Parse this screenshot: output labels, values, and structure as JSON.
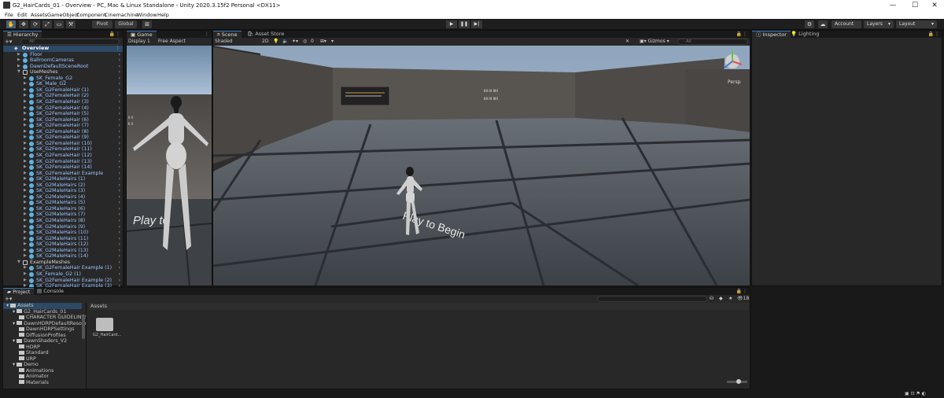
{
  "window": {
    "title": "G2_HairCards_01 - Overview - PC, Mac & Linux Standalone - Unity 2020.3.15f2 Personal <DX11>",
    "min": "—",
    "max": "☐",
    "close": "✕"
  },
  "menu": [
    "File",
    "Edit",
    "Assets",
    "GameObject",
    "Component",
    "Cinemachine",
    "Window",
    "Help"
  ],
  "toolbar": {
    "pivot": "Pivot",
    "global": "Global",
    "account": "Account",
    "layers": "Layers",
    "layout": "Layout",
    "tools": [
      "✋",
      "✥",
      "⟳",
      "⤢",
      "▭",
      "⚒"
    ],
    "play": "▶",
    "pause": "❚❚",
    "step": "▶|",
    "cloud": "☁",
    "collab": "⚙"
  },
  "hierarchy": {
    "tab": "Hierarchy",
    "search_placeholder": "All",
    "add": "+▾",
    "root": "Overview",
    "items": [
      {
        "d": 1,
        "label": "Floor",
        "type": "go"
      },
      {
        "d": 1,
        "label": "BallroomCameras",
        "type": "go"
      },
      {
        "d": 1,
        "label": "DawnDefaultSceneRoot",
        "type": "go"
      },
      {
        "d": 1,
        "label": "UseMeshes",
        "type": "grp",
        "open": true
      },
      {
        "d": 2,
        "label": "SK_Female_G2",
        "type": "go"
      },
      {
        "d": 2,
        "label": "SK_Male_G2",
        "type": "go"
      },
      {
        "d": 2,
        "label": "SK_G2FemaleHair (1)",
        "type": "go"
      },
      {
        "d": 2,
        "label": "SK_G2FemaleHair (2)",
        "type": "go"
      },
      {
        "d": 2,
        "label": "SK_G2FemaleHair (3)",
        "type": "go"
      },
      {
        "d": 2,
        "label": "SK_G2FemaleHair (4)",
        "type": "go"
      },
      {
        "d": 2,
        "label": "SK_G2FemaleHair (5)",
        "type": "go"
      },
      {
        "d": 2,
        "label": "SK_G2FemaleHair (6)",
        "type": "go"
      },
      {
        "d": 2,
        "label": "SK_G2FemaleHair (7)",
        "type": "go"
      },
      {
        "d": 2,
        "label": "SK_G2FemaleHair (8)",
        "type": "go"
      },
      {
        "d": 2,
        "label": "SK_G2FemaleHair (9)",
        "type": "go"
      },
      {
        "d": 2,
        "label": "SK_G2FemaleHair (10)",
        "type": "go"
      },
      {
        "d": 2,
        "label": "SK_G2FemaleHair (11)",
        "type": "go"
      },
      {
        "d": 2,
        "label": "SK_G2FemaleHair (12)",
        "type": "go"
      },
      {
        "d": 2,
        "label": "SK_G2FemaleHair (13)",
        "type": "go"
      },
      {
        "d": 2,
        "label": "SK_G2FemaleHair (14)",
        "type": "go"
      },
      {
        "d": 2,
        "label": "SK_G2FemaleHair Example",
        "type": "go"
      },
      {
        "d": 2,
        "label": "SK_G2MaleHairs (1)",
        "type": "go"
      },
      {
        "d": 2,
        "label": "SK_G2MaleHairs (2)",
        "type": "go"
      },
      {
        "d": 2,
        "label": "SK_G2MaleHairs (3)",
        "type": "go"
      },
      {
        "d": 2,
        "label": "SK_G2MaleHairs (4)",
        "type": "go"
      },
      {
        "d": 2,
        "label": "SK_G2MaleHairs (5)",
        "type": "go"
      },
      {
        "d": 2,
        "label": "SK_G2MaleHairs (6)",
        "type": "go"
      },
      {
        "d": 2,
        "label": "SK_G2MaleHairs (7)",
        "type": "go"
      },
      {
        "d": 2,
        "label": "SK_G2MaleHairs (8)",
        "type": "go"
      },
      {
        "d": 2,
        "label": "SK_G2MaleHairs (9)",
        "type": "go"
      },
      {
        "d": 2,
        "label": "SK_G2MaleHairs (10)",
        "type": "go"
      },
      {
        "d": 2,
        "label": "SK_G2MaleHairs (11)",
        "type": "go"
      },
      {
        "d": 2,
        "label": "SK_G2MaleHairs (12)",
        "type": "go"
      },
      {
        "d": 2,
        "label": "SK_G2MaleHairs (13)",
        "type": "go"
      },
      {
        "d": 2,
        "label": "SK_G2MaleHairs (14)",
        "type": "go"
      },
      {
        "d": 1,
        "label": "ExampleMeshes",
        "type": "grp",
        "open": true
      },
      {
        "d": 2,
        "label": "SK_G2FemaleHair Example (1)",
        "type": "go"
      },
      {
        "d": 2,
        "label": "SK_Female_G2 (1)",
        "type": "go"
      },
      {
        "d": 2,
        "label": "SK_G2FemaleHair Example (2)",
        "type": "go"
      },
      {
        "d": 2,
        "label": "SK_G2FemaleHair Example (3)",
        "type": "go"
      }
    ]
  },
  "game": {
    "tab": "Game",
    "display": "Display 1",
    "aspect": "Free Aspect",
    "sign": "Play to",
    "tiny": "ꞁꞁ ꞁꞁ"
  },
  "scene": {
    "tab": "Scene",
    "tab2": "Asset Store",
    "shading": "Shaded",
    "mode2d": "2D",
    "gizmos": "Gizmos",
    "search_placeholder": "All",
    "persp": "Persp",
    "floor_text": "Play to Begin",
    "board": "ꞁꞁꞁꞁ ꞁꞁꞁ ꞁꞁꞁꞁꞁ",
    "count": "0"
  },
  "inspector": {
    "tab": "Inspector",
    "tab2": "Lighting"
  },
  "project": {
    "tab": "Project",
    "tab2": "Console",
    "add": "+▾",
    "breadcrumb": "Assets",
    "count": "18",
    "search_placeholder": "",
    "tree": [
      {
        "d": 0,
        "label": "Assets",
        "sel": true
      },
      {
        "d": 1,
        "label": "G2_HairCards_01"
      },
      {
        "d": 2,
        "label": "CHARACTER GUIDELINES"
      },
      {
        "d": 1,
        "label": "DawnHDRPDefaultResour"
      },
      {
        "d": 2,
        "label": "DawnHDRPSettings"
      },
      {
        "d": 2,
        "label": "DiffusionProfiles"
      },
      {
        "d": 1,
        "label": "DawnShaders_V2"
      },
      {
        "d": 2,
        "label": "HDRP"
      },
      {
        "d": 2,
        "label": "Standard"
      },
      {
        "d": 2,
        "label": "URP"
      },
      {
        "d": 1,
        "label": "Demo"
      },
      {
        "d": 2,
        "label": "Animations"
      },
      {
        "d": 2,
        "label": "Animator"
      },
      {
        "d": 2,
        "label": "Materials"
      }
    ],
    "grid": [
      {
        "label": "G2_HairCard..."
      }
    ]
  }
}
